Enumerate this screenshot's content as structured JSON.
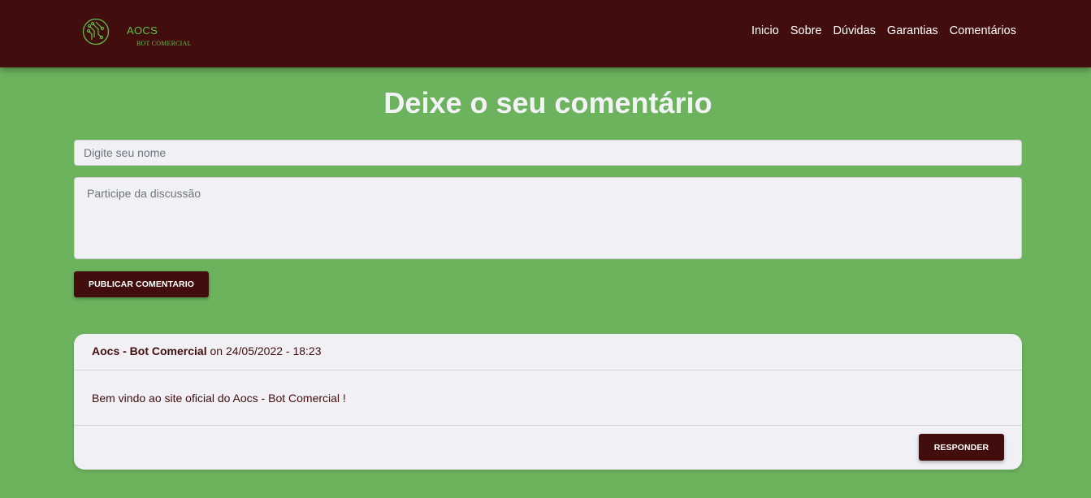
{
  "brand": {
    "name": "AOCS",
    "subtitle": "BOT COMERCIAL"
  },
  "nav": {
    "items": [
      {
        "label": "Inicio"
      },
      {
        "label": "Sobre"
      },
      {
        "label": "Dúvidas"
      },
      {
        "label": "Garantias"
      },
      {
        "label": "Comentários"
      }
    ]
  },
  "page": {
    "title": "Deixe o seu comentário"
  },
  "form": {
    "name_placeholder": "Digite seu nome",
    "comment_placeholder": "Participe da discussão",
    "publish_label": "PUBLICAR COMENTARIO"
  },
  "comment": {
    "author": "Aocs - Bot Comercial",
    "meta": " on 24/05/2022 - 18:23",
    "body": "Bem vindo ao site oficial do Aocs - Bot Comercial !",
    "reply_label": "RESPONDER"
  },
  "colors": {
    "background": "#6db35e",
    "navbar": "#420e0d",
    "accent_green": "#5fbf4e",
    "card": "#f0f0f5"
  }
}
